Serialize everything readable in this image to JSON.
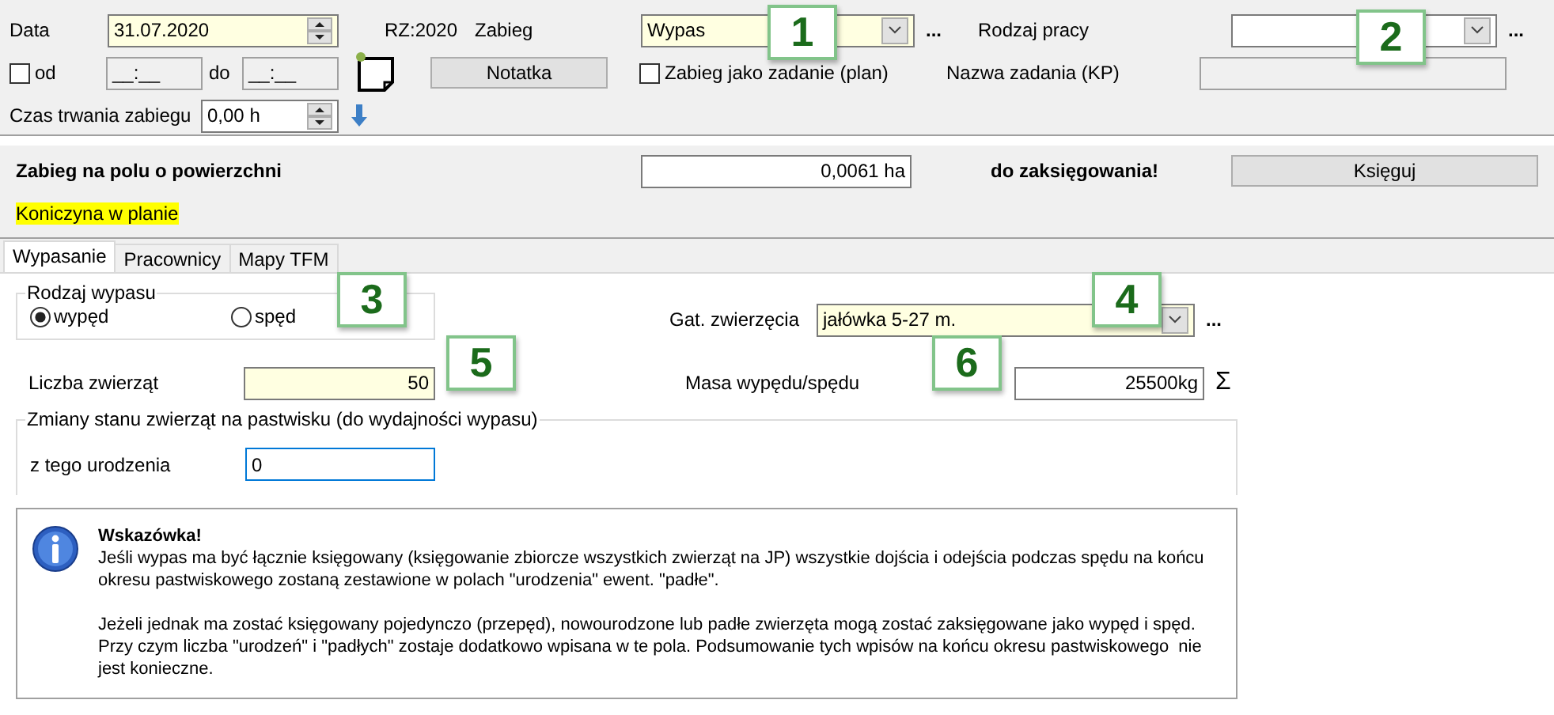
{
  "header": {
    "date_label": "Data",
    "date": "31.07.2020",
    "year": "RZ:2020",
    "operation_label": "Zabieg",
    "operation": "Wypas",
    "operation_more": "...",
    "work_type_label": "Rodzaj pracy",
    "work_type_more": "...",
    "from": {
      "label": "od",
      "checked": false
    },
    "from_time": "__:__",
    "to_label": "do",
    "to_time": "__:__",
    "note_button": "Notatka",
    "plan_task": {
      "label": "Zabieg jako zadanie (plan)",
      "checked": false
    },
    "task_name_label": "Nazwa zadania (KP)",
    "duration_label": "Czas trwania zabiegu",
    "duration": "0,00 h"
  },
  "area": {
    "label": "Zabieg na polu o powierzchni",
    "value": "0,0061 ha",
    "status": "do zaksięgowania!",
    "button": "Księguj"
  },
  "plan_note": "Koniczyna w planie",
  "tabs": [
    {
      "label": "Wypasanie",
      "selected": true
    },
    {
      "label": "Pracownicy",
      "selected": false
    },
    {
      "label": "Mapy TFM",
      "selected": false
    }
  ],
  "grazing": {
    "group_label": "Rodzaj wypasu",
    "options": [
      {
        "label": "wypęd",
        "selected": true
      },
      {
        "label": "spęd",
        "selected": false
      }
    ],
    "animal_type_label": "Gat. zwierzęcia",
    "animal_type": "jałówka 5-27 m.",
    "animal_type_more": "...",
    "count_label": "Liczba zwierząt",
    "count": "50",
    "mass_label": "Masa wypędu/spędu",
    "mass": "25500kg",
    "sum": "Σ"
  },
  "changes": {
    "group_label": "Zmiany stanu zwierząt na pastwisku (do wydajności wypasu)",
    "born_label": "z tego urodzenia",
    "born": "0"
  },
  "hint": {
    "title": "Wskazówka!",
    "paragraphs": [
      "Jeśli wypas ma być łącznie księgowany (księgowanie zbiorcze wszystkich zwierząt na JP) wszystkie dojścia i odejścia podczas spędu na końcu okresu pastwiskowego zostaną zestawione w polach \"urodzenia\" ewent. \"padłe\".",
      "Jeżeli jednak ma zostać księgowany pojedynczo (przepęd), nowourodzone lub padłe zwierzęta mogą zostać zaksięgowane jako wypęd i spęd. Przy czym liczba \"urodzeń\" i \"padłych\" zostaje dodatkowo wpisana w te pola. Podsumowanie tych wpisów na końcu okresu pastwiskowego  nie jest konieczne."
    ]
  },
  "callouts": [
    "1",
    "2",
    "3",
    "4",
    "5",
    "6"
  ]
}
